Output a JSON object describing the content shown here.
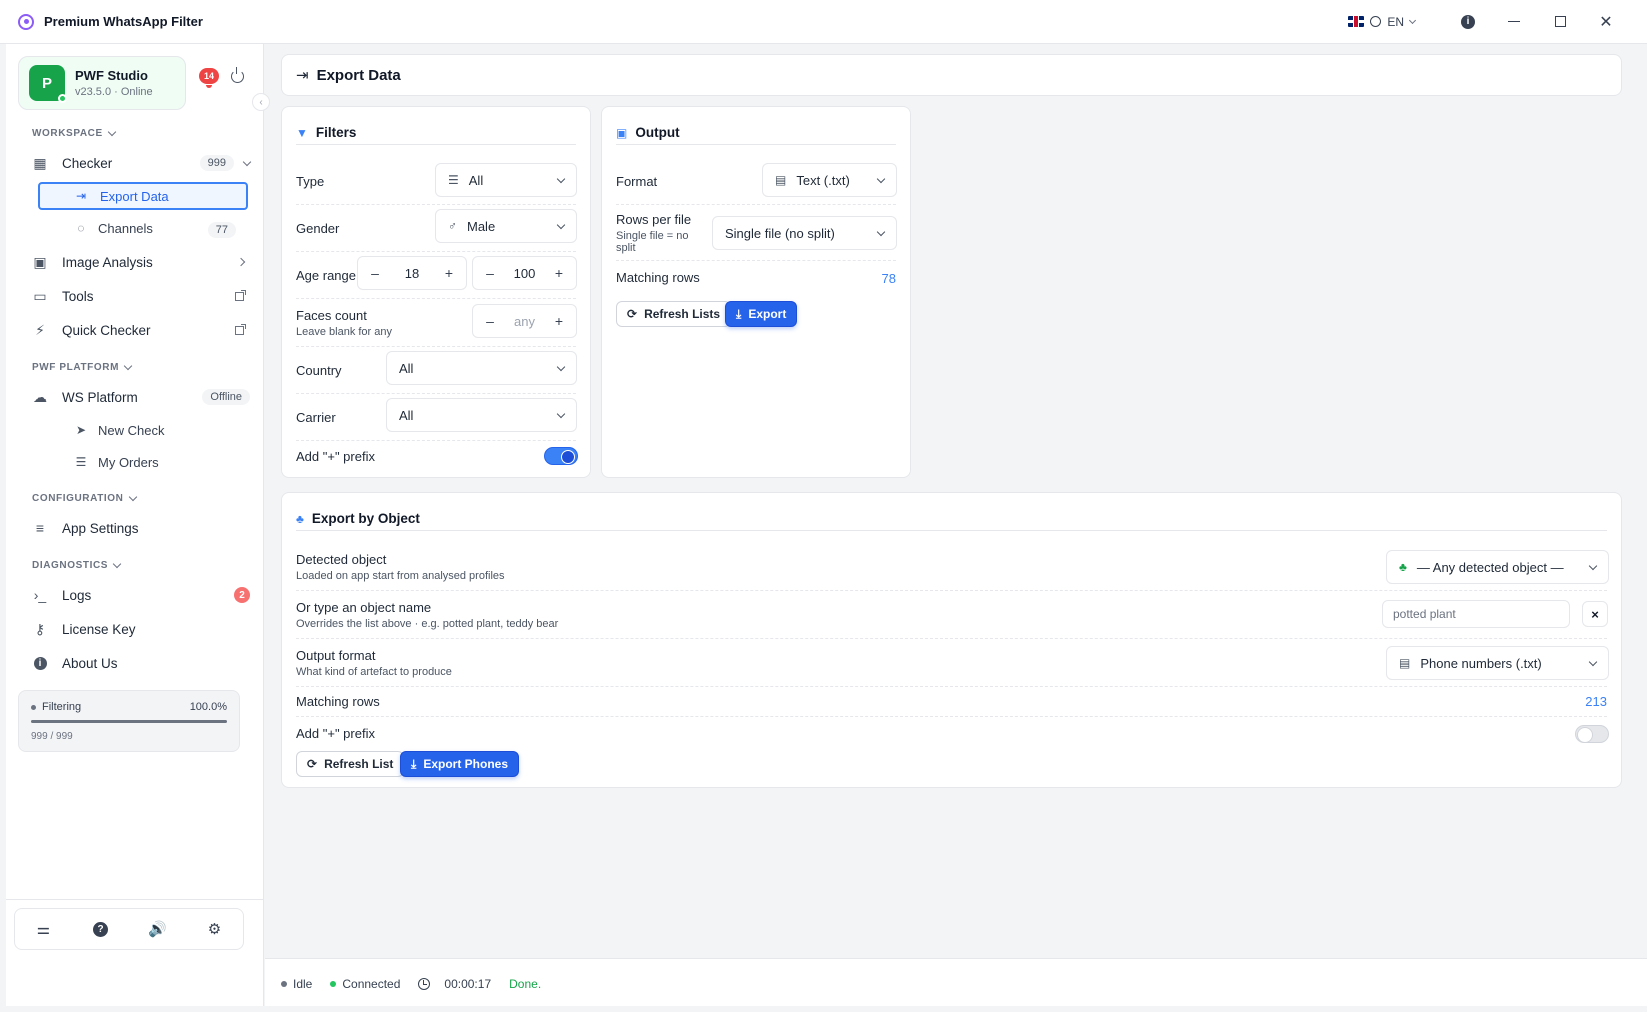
{
  "app": {
    "title": "Premium WhatsApp Filter",
    "language": "EN"
  },
  "profile": {
    "initial": "P",
    "name": "PWF Studio",
    "subtitle": "v23.5.0 · Online",
    "notifications": "14"
  },
  "sidebar": {
    "sections": {
      "workspace": "WORKSPACE",
      "platform": "PWF PLATFORM",
      "configuration": "CONFIGURATION",
      "diagnostics": "DIAGNOSTICS"
    },
    "checker": {
      "label": "Checker",
      "count": "999"
    },
    "export_data": {
      "label": "Export Data"
    },
    "channels": {
      "label": "Channels",
      "count": "77"
    },
    "image_analysis": {
      "label": "Image Analysis"
    },
    "tools": {
      "label": "Tools"
    },
    "quick_checker": {
      "label": "Quick Checker"
    },
    "ws_platform": {
      "label": "WS Platform",
      "status": "Offline"
    },
    "new_check": {
      "label": "New Check"
    },
    "my_orders": {
      "label": "My Orders"
    },
    "app_settings": {
      "label": "App Settings"
    },
    "logs": {
      "label": "Logs",
      "count": "2"
    },
    "license_key": {
      "label": "License Key"
    },
    "about_us": {
      "label": "About Us"
    }
  },
  "progress": {
    "label": "Filtering",
    "percent_text": "100.0%",
    "fraction": 1.0,
    "count": "999 / 999"
  },
  "page": {
    "title": "Export Data"
  },
  "filters": {
    "title": "Filters",
    "type": {
      "label": "Type",
      "value": "All"
    },
    "gender": {
      "label": "Gender",
      "value": "Male"
    },
    "age_range": {
      "label": "Age range",
      "min": "18",
      "max": "100",
      "minus": "–",
      "plus": "+"
    },
    "faces_count": {
      "label": "Faces count",
      "hint": "Leave blank for any",
      "placeholder": "any",
      "minus": "–",
      "plus": "+"
    },
    "country": {
      "label": "Country",
      "value": "All"
    },
    "carrier": {
      "label": "Carrier",
      "value": "All"
    },
    "add_prefix": {
      "label": "Add \"+\" prefix",
      "on": true
    }
  },
  "output": {
    "title": "Output",
    "format": {
      "label": "Format",
      "value": "Text (.txt)"
    },
    "rows_per_file": {
      "label": "Rows per file",
      "hint": "Single file = no split",
      "value": "Single file (no split)"
    },
    "matching_rows": {
      "label": "Matching rows",
      "value": "78"
    },
    "refresh_label": "Refresh Lists",
    "export_label": "Export"
  },
  "export_by_object": {
    "title": "Export by Object",
    "detected_object": {
      "label": "Detected object",
      "hint": "Loaded on app start from analysed profiles",
      "value": "— Any detected object —"
    },
    "object_name": {
      "label": "Or type an object name",
      "hint": "Overrides the list above · e.g. potted plant, teddy bear",
      "placeholder": "potted plant",
      "clear": "×"
    },
    "output_format": {
      "label": "Output format",
      "hint": "What kind of artefact to produce",
      "value": "Phone numbers (.txt)"
    },
    "matching_rows": {
      "label": "Matching rows",
      "value": "213"
    },
    "add_prefix": {
      "label": "Add \"+\" prefix",
      "on": false
    },
    "refresh_label": "Refresh List",
    "export_label": "Export Phones"
  },
  "status": {
    "state": "Idle",
    "connection": "Connected",
    "timer": "00:00:17",
    "message": "Done."
  },
  "colors": {
    "accent": "#2563eb",
    "success": "#16a34a",
    "danger": "#ef4444",
    "muted": "#6b7280"
  }
}
